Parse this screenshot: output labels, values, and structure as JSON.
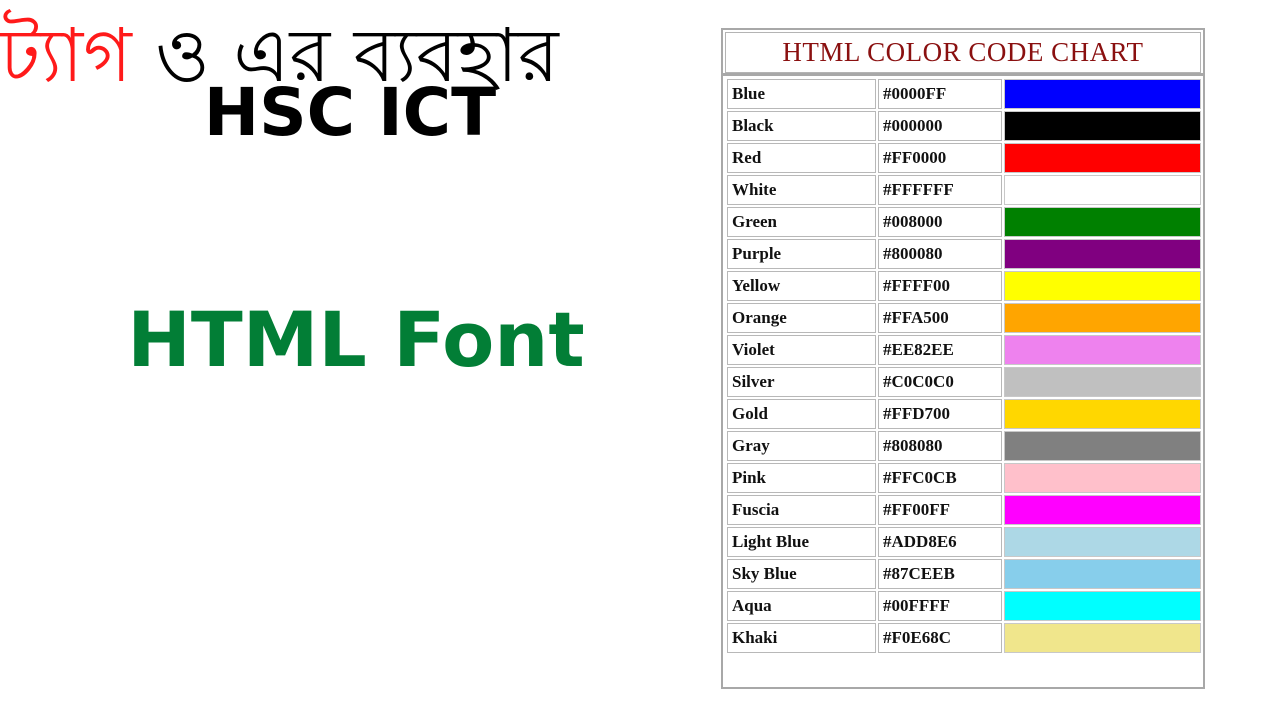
{
  "left": {
    "line1": "HSC ICT",
    "line2": "HTML Font",
    "line3_red": "ট্যাগ",
    "line3_rest": " ও এর ব্যবহার"
  },
  "colors": {
    "line1": "#000000",
    "line2": "#027e36",
    "line3_red": "#ff1a1a",
    "line3_rest": "#000000",
    "chart_title": "#8a1010"
  },
  "chart": {
    "title": "HTML COLOR CODE CHART",
    "rows": [
      {
        "name": "Blue",
        "code": "#0000FF",
        "swatch": "#0000FF"
      },
      {
        "name": "Black",
        "code": "#000000",
        "swatch": "#000000"
      },
      {
        "name": "Red",
        "code": "#FF0000",
        "swatch": "#FF0000"
      },
      {
        "name": "White",
        "code": "#FFFFFF",
        "swatch": "#FFFFFF"
      },
      {
        "name": "Green",
        "code": "#008000",
        "swatch": "#008000"
      },
      {
        "name": "Purple",
        "code": "#800080",
        "swatch": "#800080"
      },
      {
        "name": "Yellow",
        "code": "#FFFF00",
        "swatch": "#FFFF00"
      },
      {
        "name": "Orange",
        "code": "#FFA500",
        "swatch": "#FFA500"
      },
      {
        "name": "Violet",
        "code": "#EE82EE",
        "swatch": "#EE82EE"
      },
      {
        "name": "Silver",
        "code": "#C0C0C0",
        "swatch": "#C0C0C0"
      },
      {
        "name": "Gold",
        "code": "#FFD700",
        "swatch": "#FFD700"
      },
      {
        "name": "Gray",
        "code": "#808080",
        "swatch": "#808080"
      },
      {
        "name": "Pink",
        "code": "#FFC0CB",
        "swatch": "#FFC0CB"
      },
      {
        "name": "Fuscia",
        "code": "#FF00FF",
        "swatch": "#FF00FF"
      },
      {
        "name": "Light Blue",
        "code": "#ADD8E6",
        "swatch": "#ADD8E6"
      },
      {
        "name": "Sky Blue",
        "code": "#87CEEB",
        "swatch": "#87CEEB"
      },
      {
        "name": "Aqua",
        "code": "#00FFFF",
        "swatch": "#00FFFF"
      },
      {
        "name": "Khaki",
        "code": "#F0E68C",
        "swatch": "#F0E68C"
      }
    ]
  }
}
